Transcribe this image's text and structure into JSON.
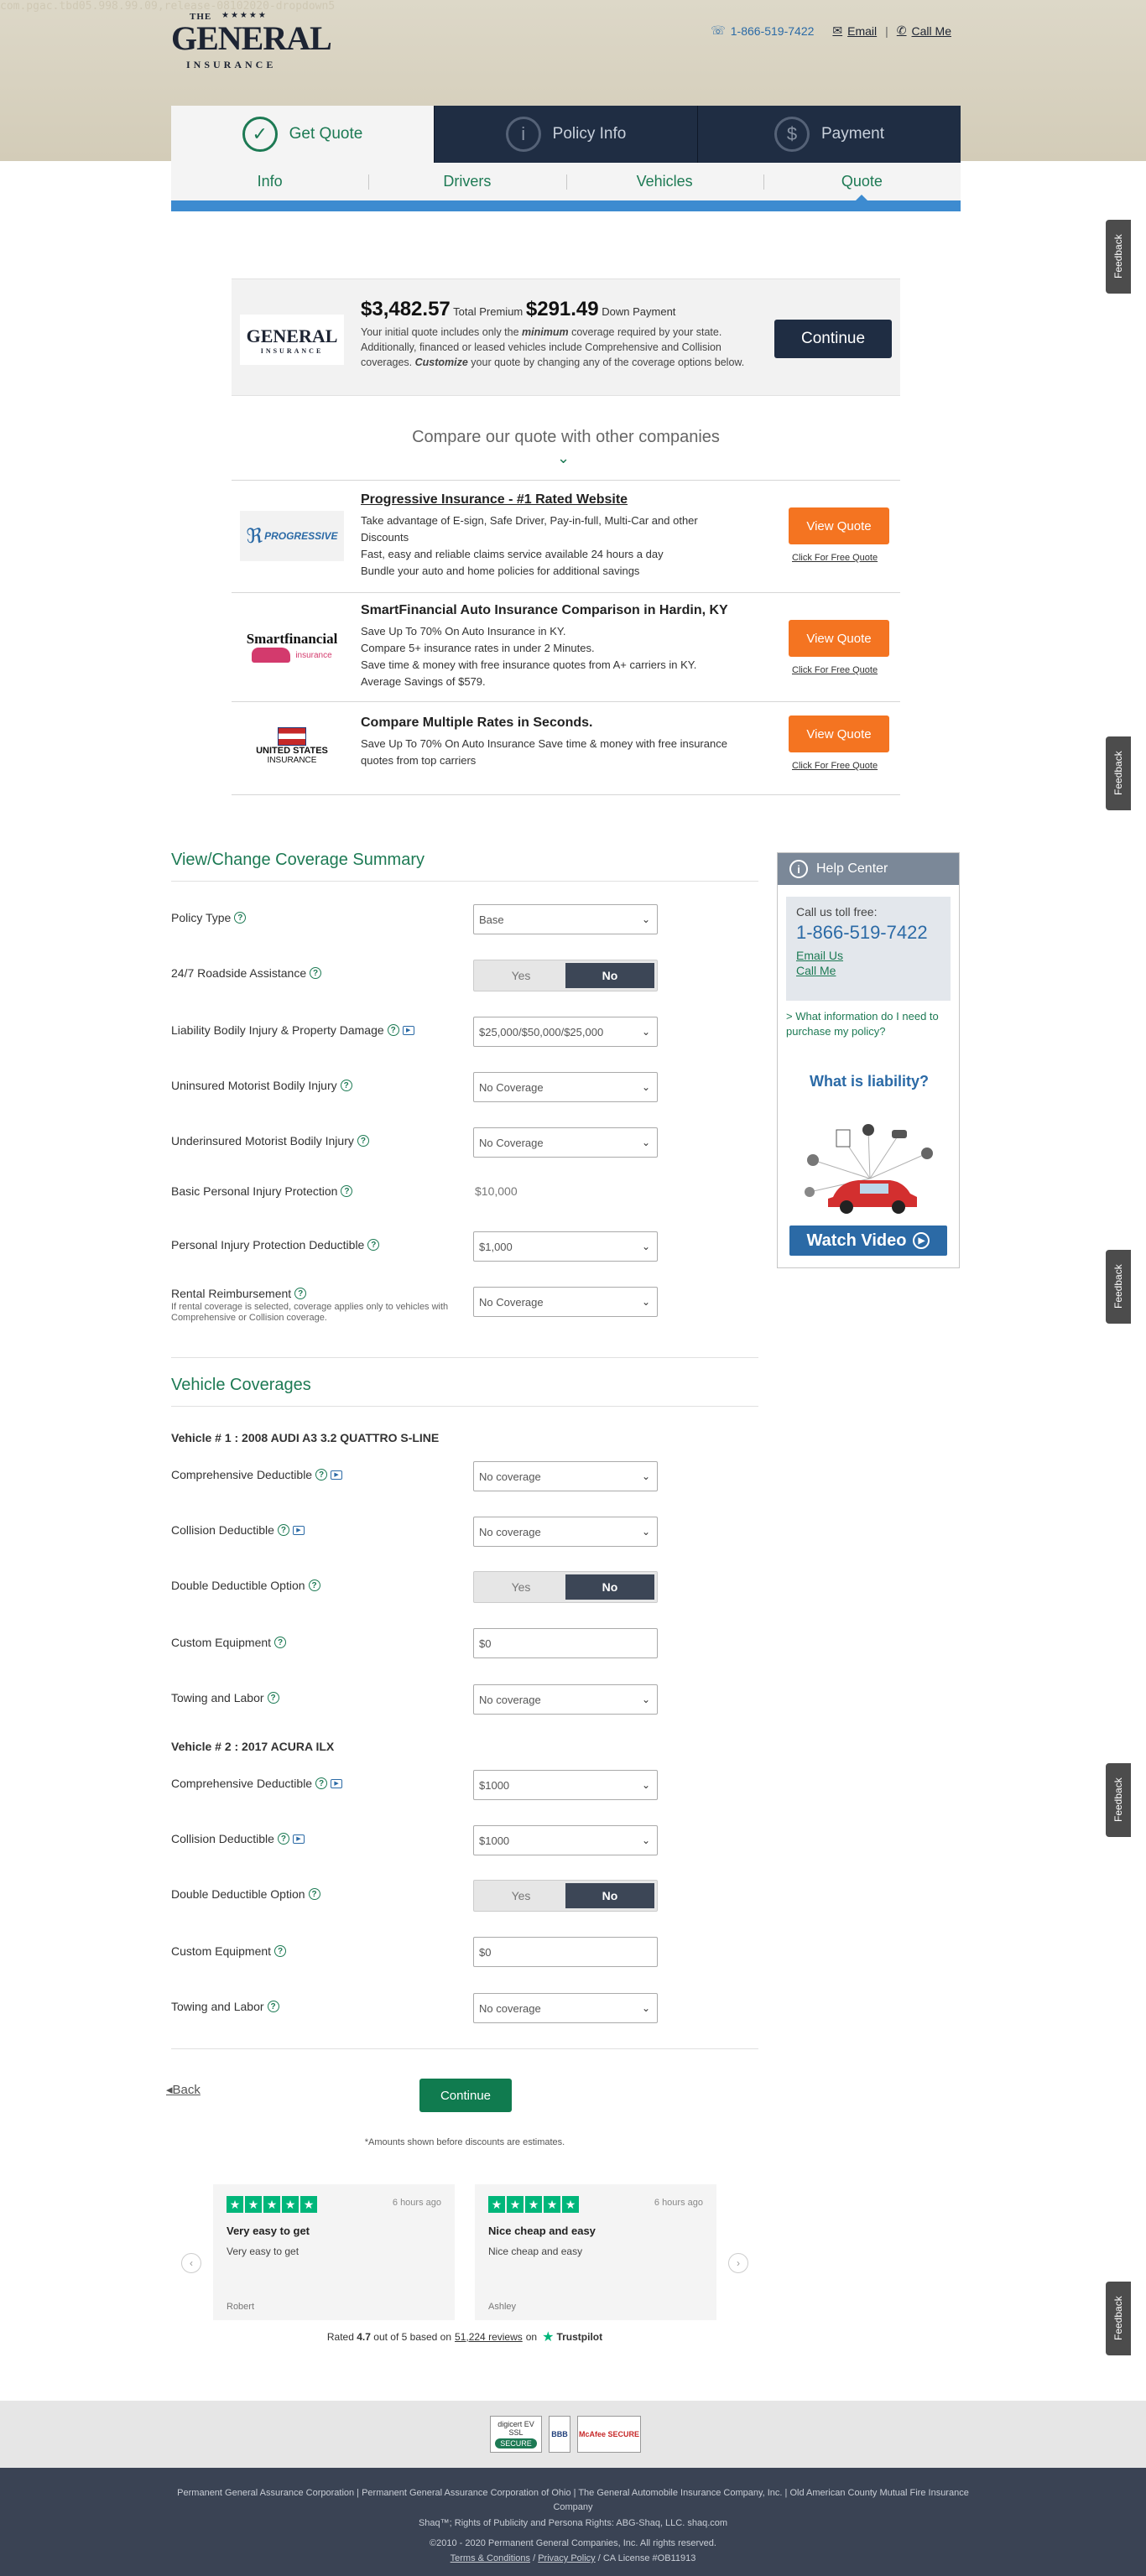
{
  "header": {
    "watermark": "com.pgac.tbd05.998.99.09,release-08102020-dropdown5",
    "logo": {
      "the": "THE",
      "stars": "★★★★★",
      "name": "GENERAL",
      "reg": "®",
      "sub": "INSURANCE"
    },
    "phone": "1-866-519-7422",
    "email_label": "Email",
    "call_label": "Call Me",
    "divider": "|"
  },
  "tabs": [
    {
      "label": "Get Quote",
      "icon": "✓",
      "active": true
    },
    {
      "label": "Policy Info",
      "icon": "i",
      "active": false
    },
    {
      "label": "Payment",
      "icon": "$",
      "active": false
    }
  ],
  "subtabs": [
    {
      "label": "Info"
    },
    {
      "label": "Drivers"
    },
    {
      "label": "Vehicles"
    },
    {
      "label": "Quote",
      "active": true
    }
  ],
  "quote": {
    "logo_name": "GENERAL",
    "logo_sub": "INSURANCE",
    "total_premium": "$3,482.57",
    "total_premium_label": "Total Premium",
    "down_payment": "$291.49",
    "down_payment_label": "Down Payment",
    "desc_1": "Your initial quote includes only the ",
    "desc_minimum": "minimum",
    "desc_2": " coverage required by your state. Additionally, financed or leased vehicles include Comprehensive and Collision coverages. ",
    "desc_customize": "Customize",
    "desc_3": " your quote by changing any of the coverage options below.",
    "continue_label": "Continue"
  },
  "compare": {
    "title": "Compare our quote with other companies",
    "chevron": "⌄"
  },
  "ads": [
    {
      "logo": "PROGRESSIVE",
      "title": "Progressive Insurance - #1 Rated Website",
      "lines": [
        "Take advantage of E-sign, Safe Driver, Pay-in-full, Multi-Car and other Discounts",
        "Fast, easy and reliable claims service available 24 hours a day",
        "Bundle your auto and home policies for additional savings"
      ],
      "button": "View Quote",
      "free": "Click For Free Quote"
    },
    {
      "logo": "Smartfinancial",
      "logo_sub": "insurance",
      "title": "SmartFinancial Auto Insurance Comparison in Hardin, KY",
      "lines": [
        "Save Up To 70% On Auto Insurance in KY.",
        "Compare 5+ insurance rates in under 2 Minutes.",
        "Save time & money with free insurance quotes from A+ carriers in KY.",
        "Average Savings of $579."
      ],
      "button": "View Quote",
      "free": "Click For Free Quote"
    },
    {
      "logo": "UNITED STATES",
      "logo_sub": "INSURANCE",
      "title": "Compare Multiple Rates in Seconds.",
      "lines": [
        "Save Up To 70% On Auto Insurance Save time & money with free insurance quotes from top carriers"
      ],
      "button": "View Quote",
      "free": "Click For Free Quote"
    }
  ],
  "coverage": {
    "title": "View/Change Coverage Summary",
    "policy_type": {
      "label": "Policy Type",
      "value": "Base"
    },
    "roadside": {
      "label": "24/7 Roadside Assistance",
      "yes": "Yes",
      "no": "No",
      "selected": "No"
    },
    "liability": {
      "label": "Liability Bodily Injury & Property Damage",
      "value": "$25,000/$50,000/$25,000"
    },
    "uninsured": {
      "label": "Uninsured Motorist Bodily Injury",
      "value": "No Coverage"
    },
    "underinsured": {
      "label": "Underinsured Motorist Bodily Injury",
      "value": "No Coverage"
    },
    "basic_pip": {
      "label": "Basic Personal Injury Protection",
      "value": "$10,000"
    },
    "pip_deductible": {
      "label": "Personal Injury Protection Deductible",
      "value": "$1,000"
    },
    "rental": {
      "label": "Rental Reimbursement",
      "note": "If rental coverage is selected, coverage applies only to vehicles with Comprehensive or Collision coverage.",
      "value": "No Coverage"
    }
  },
  "vehicles_section": {
    "title": "Vehicle Coverages",
    "vehicles": [
      {
        "title": "Vehicle # 1 : 2008 AUDI A3 3.2 QUATTRO S-LINE",
        "comprehensive": {
          "label": "Comprehensive Deductible",
          "value": "No coverage"
        },
        "collision": {
          "label": "Collision Deductible",
          "value": "No coverage"
        },
        "double": {
          "label": "Double Deductible Option",
          "yes": "Yes",
          "no": "No",
          "selected": "No"
        },
        "custom_equipment": {
          "label": "Custom Equipment",
          "value": "$0"
        },
        "towing": {
          "label": "Towing and Labor",
          "value": "No coverage"
        }
      },
      {
        "title": "Vehicle # 2 : 2017 ACURA ILX",
        "comprehensive": {
          "label": "Comprehensive Deductible",
          "value": "$1000"
        },
        "collision": {
          "label": "Collision Deductible",
          "value": "$1000"
        },
        "double": {
          "label": "Double Deductible Option",
          "yes": "Yes",
          "no": "No",
          "selected": "No"
        },
        "custom_equipment": {
          "label": "Custom Equipment",
          "value": "$0"
        },
        "towing": {
          "label": "Towing and Labor",
          "value": "No coverage"
        }
      }
    ]
  },
  "help": {
    "title": "Help Center",
    "call_label": "Call us toll free:",
    "phone": "1-866-519-7422",
    "email_us": "Email Us",
    "call_me": "Call Me",
    "question": "> What information do I need to purchase my policy?",
    "liability_q": "What is liability?",
    "video": "Watch Video"
  },
  "actions": {
    "back": "Back",
    "back_icon": "◂",
    "continue": "Continue",
    "disclaimer": "*Amounts shown before discounts are estimates."
  },
  "trustpilot": {
    "reviews": [
      {
        "time": "6 hours ago",
        "title": "Very easy to get",
        "body": "Very easy to get",
        "name": "Robert"
      },
      {
        "time": "6 hours ago",
        "title": "Nice cheap and easy",
        "body": "Nice cheap and easy",
        "name": "Ashley"
      }
    ],
    "rated": "Rated",
    "score": "4.7",
    "out_of": "out of 5 based on",
    "count": "51,224 reviews",
    "on": "on",
    "brand": "Trustpilot",
    "prev": "‹",
    "next": "›"
  },
  "badges": {
    "digicert": "digicert EV SSL",
    "digicert_sub": "SECURE",
    "bbb": "BBB",
    "mcafee": "McAfee SECURE"
  },
  "footer": {
    "line1": "Permanent General Assurance Corporation | Permanent General Assurance Corporation of Ohio | The General Automobile Insurance Company, Inc. | Old American County Mutual Fire Insurance Company",
    "line2": "Shaq™; Rights of Publicity and Persona Rights: ABG-Shaq, LLC. shaq.com",
    "line3": "©2010 - 2020 Permanent General Companies, Inc. All rights reserved.",
    "terms": "Terms & Conditions",
    "privacy": "Privacy Policy",
    "license": "/ CA License #OB11913"
  },
  "feedback_label": "Feedback",
  "colors": {
    "brand_green": "#1d7a54",
    "navy": "#1f2d43",
    "orange": "#f47421",
    "blue": "#2b6aa6",
    "trustpilot": "#00b67a"
  }
}
